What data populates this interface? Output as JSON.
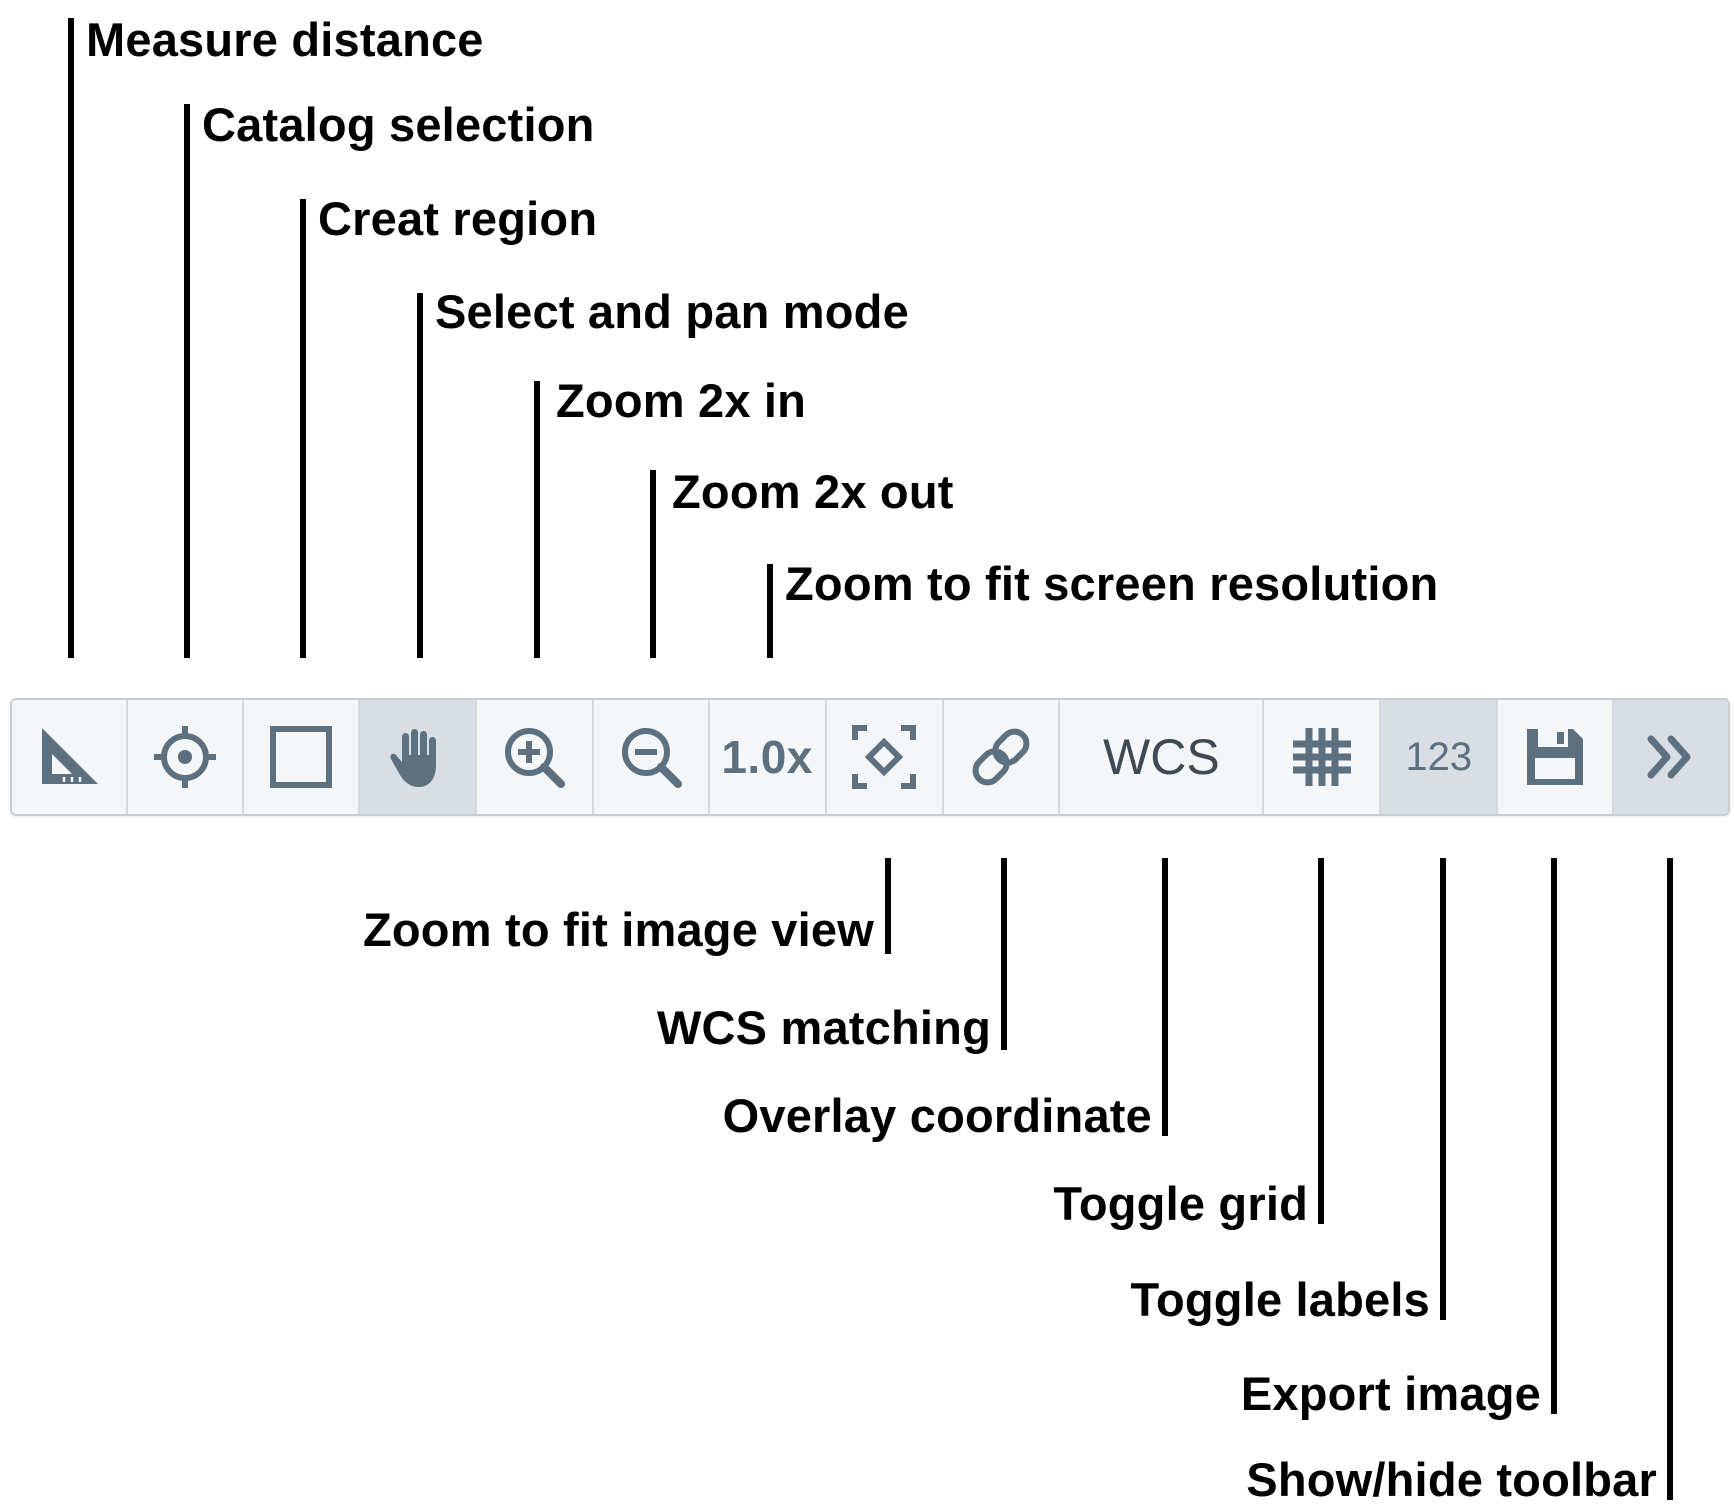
{
  "annotations_top": [
    "Measure distance",
    "Catalog selection",
    "Creat region",
    "Select and pan mode",
    "Zoom 2x in",
    "Zoom 2x out",
    "Zoom to fit screen resolution"
  ],
  "annotations_bottom": [
    "Zoom to fit image view",
    "WCS matching",
    "Overlay coordinate",
    "Toggle grid",
    "Toggle labels",
    "Export image",
    "Show/hide toolbar"
  ],
  "toolbar": {
    "zoom_level": "1.0x",
    "coordinate_system": "WCS",
    "labels_text": "123",
    "active_buttons": [
      "pan-mode",
      "toggle-labels",
      "show-hide-toolbar"
    ],
    "colors": {
      "icon": "#5c7080",
      "background": "#f5f6f7",
      "active_background": "#d8dee4",
      "border": "#c9ced3"
    }
  }
}
